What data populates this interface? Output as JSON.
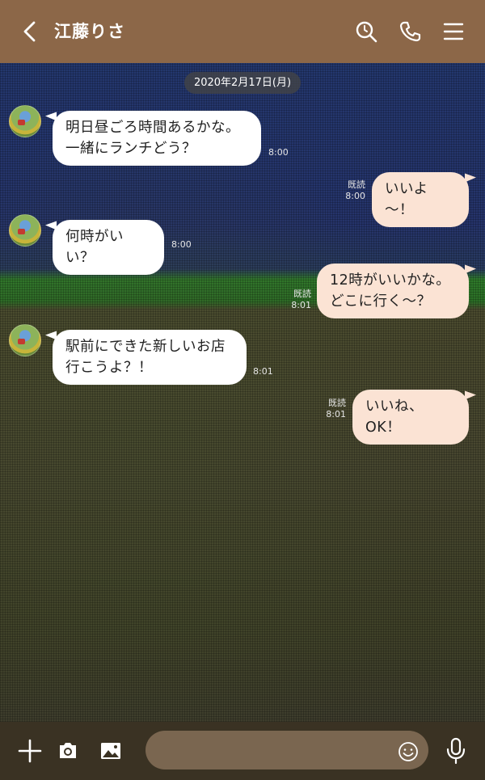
{
  "header": {
    "title": "江藤りさ",
    "icons": [
      "back-icon",
      "search-icon",
      "phone-icon",
      "menu-icon"
    ],
    "color": "#8c6748"
  },
  "chat": {
    "date": "2020年2月17日(月)",
    "messages": [
      {
        "side": "in",
        "lines": [
          "明日昼ごろ時間あるかな。",
          "一緒にランチどう？"
        ],
        "time": "8:00"
      },
      {
        "side": "out",
        "lines": [
          "いいよ～！"
        ],
        "read": "既読",
        "time": "8:00"
      },
      {
        "side": "in",
        "lines": [
          "何時がいい？"
        ],
        "time": "8:00"
      },
      {
        "side": "out",
        "lines": [
          "12時がいいかな。",
          "どこに行く～？"
        ],
        "read": "既読",
        "time": "8:01"
      },
      {
        "side": "in",
        "lines": [
          "駅前にできた新しいお店",
          "行こうよ？！"
        ],
        "time": "8:01"
      },
      {
        "side": "out",
        "lines": [
          "いいね、OK！"
        ],
        "read": "既読",
        "time": "8:01"
      }
    ]
  },
  "input": {
    "value": "",
    "placeholder": "",
    "icons": [
      "plus-icon",
      "camera-icon",
      "image-icon",
      "emoji-icon",
      "microphone-icon"
    ]
  }
}
